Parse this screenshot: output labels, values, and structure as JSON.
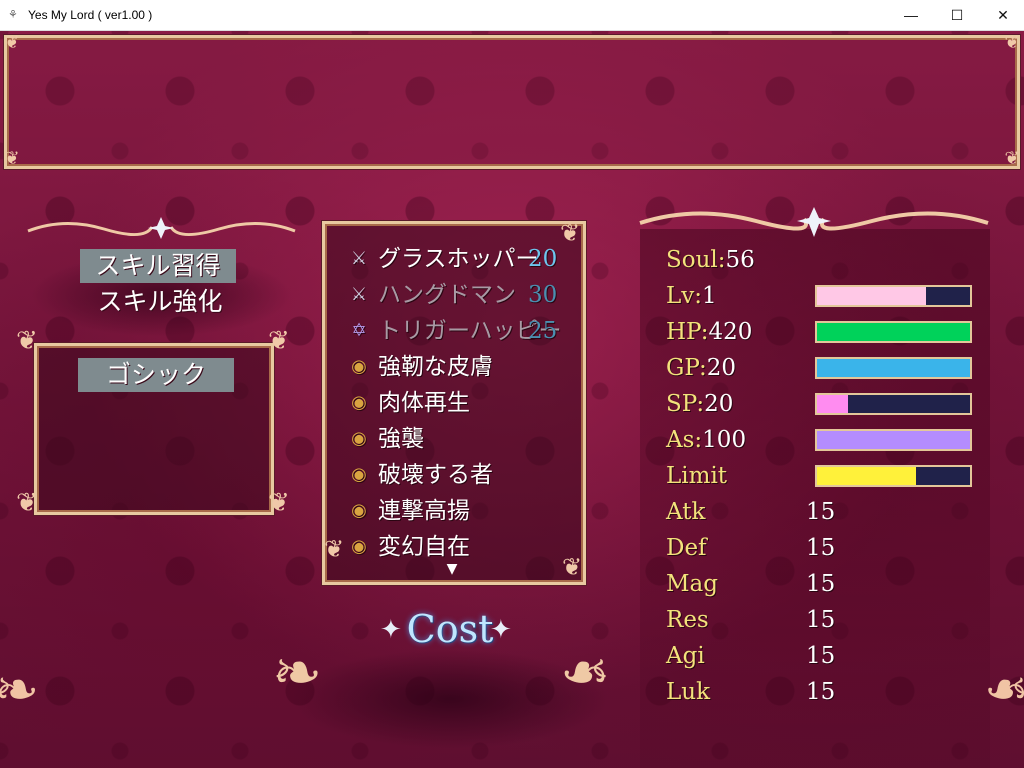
{
  "window": {
    "title": "Yes My Lord ( ver1.00 )",
    "minimize": "—",
    "maximize": "☐",
    "close": "✕"
  },
  "commands": [
    {
      "label": "スキル習得",
      "selected": true
    },
    {
      "label": "スキル強化",
      "selected": false
    }
  ],
  "category": {
    "label": "ゴシック"
  },
  "skills": [
    {
      "name": "グラスホッパー",
      "cost": "20",
      "icon": "crossed-swords-icon",
      "dim": false
    },
    {
      "name": "ハングドマン",
      "cost": "30",
      "icon": "crossed-swords-icon",
      "dim": true
    },
    {
      "name": "トリガーハッピー",
      "cost": "25",
      "icon": "hexagram-icon",
      "dim": true
    },
    {
      "name": "強靭な皮膚",
      "cost": "",
      "icon": "gold-coin-icon",
      "dim": false
    },
    {
      "name": "肉体再生",
      "cost": "",
      "icon": "gold-coin-icon",
      "dim": false
    },
    {
      "name": "強襲",
      "cost": "",
      "icon": "gold-coin-icon",
      "dim": false
    },
    {
      "name": "破壊する者",
      "cost": "",
      "icon": "gold-coin-icon",
      "dim": false
    },
    {
      "name": "連撃高揚",
      "cost": "",
      "icon": "gold-coin-icon",
      "dim": false
    },
    {
      "name": "変幻自在",
      "cost": "",
      "icon": "gold-coin-icon",
      "dim": false
    }
  ],
  "cost_title": "Cost",
  "stats": {
    "soul": {
      "label": "Soul",
      "sep": ":",
      "value": "56"
    },
    "bars": [
      {
        "label": "Lv",
        "value": "1",
        "fill": 0.71,
        "color": "#ffc8e6"
      },
      {
        "label": "HP",
        "value": "420",
        "fill": 1.0,
        "color": "#00d25a"
      },
      {
        "label": "GP",
        "value": "20",
        "fill": 1.0,
        "color": "#3ab4ea"
      },
      {
        "label": "SP",
        "value": "20",
        "fill": 0.2,
        "color": "#ff8cf0"
      },
      {
        "label": "As",
        "value": "100",
        "fill": 1.0,
        "color": "#b48cff"
      },
      {
        "label": "Limit",
        "value": "",
        "fill": 0.65,
        "color": "#fff13a"
      }
    ],
    "attributes": [
      {
        "label": "Atk",
        "value": "15"
      },
      {
        "label": "Def",
        "value": "15"
      },
      {
        "label": "Mag",
        "value": "15"
      },
      {
        "label": "Res",
        "value": "15"
      },
      {
        "label": "Agi",
        "value": "15"
      },
      {
        "label": "Luk",
        "value": "15"
      }
    ]
  },
  "colors": {
    "label_gold": "#f4e27c",
    "cost_blue": "#6ec6ee",
    "frame_gold": "#e8c9a0"
  }
}
